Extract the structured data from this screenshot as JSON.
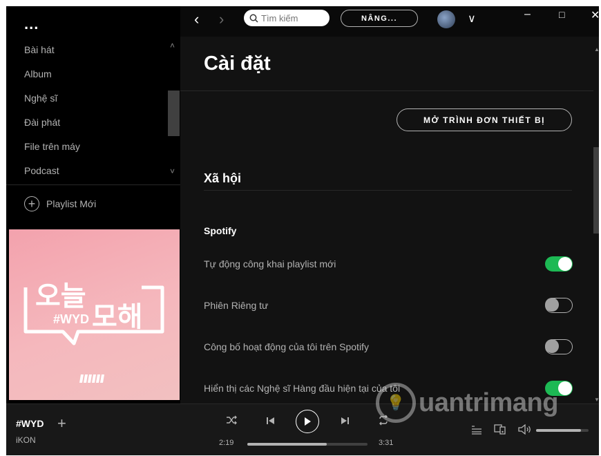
{
  "sidebar": {
    "menu_dots": "...",
    "library_items": [
      {
        "label": "Bài hát"
      },
      {
        "label": "Album"
      },
      {
        "label": "Nghệ sĩ"
      },
      {
        "label": "Đài phát"
      },
      {
        "label": "File trên máy"
      },
      {
        "label": "Podcast"
      }
    ],
    "new_playlist_label": "Playlist Mới",
    "cover_art": {
      "hashtag": "#WYD",
      "korean_top": "오늘",
      "korean_bottom": "모해",
      "brand_mark": "iKON",
      "background": "#f3a9b0"
    }
  },
  "topbar": {
    "search_placeholder": "Tìm kiếm",
    "upgrade_label": "NÂNG...",
    "icons": [
      "chevron-left-icon",
      "chevron-right-icon",
      "search-icon",
      "chevron-down-icon",
      "minimize-icon",
      "maximize-icon",
      "close-icon"
    ]
  },
  "settings": {
    "page_title": "Cài đặt",
    "device_menu_button": "MỞ TRÌNH ĐƠN THIẾT BỊ",
    "section_title": "Xã hội",
    "subsection_title": "Spotify",
    "rows": [
      {
        "label": "Tự động công khai playlist mới",
        "on": true
      },
      {
        "label": "Phiên Riêng tư",
        "on": false
      },
      {
        "label": "Công bố hoạt động của tôi trên Spotify",
        "on": false
      },
      {
        "label": "Hiển thị các Nghệ sĩ Hàng đầu hiện tại của tôi",
        "on": true
      }
    ],
    "toggle_on_color": "#1db954"
  },
  "player": {
    "track_title": "#WYD",
    "artist": "iKON",
    "elapsed": "2:19",
    "duration": "3:31",
    "progress_fraction": 0.66,
    "volume_fraction": 0.85
  },
  "watermark": {
    "text": "uantrimang"
  }
}
